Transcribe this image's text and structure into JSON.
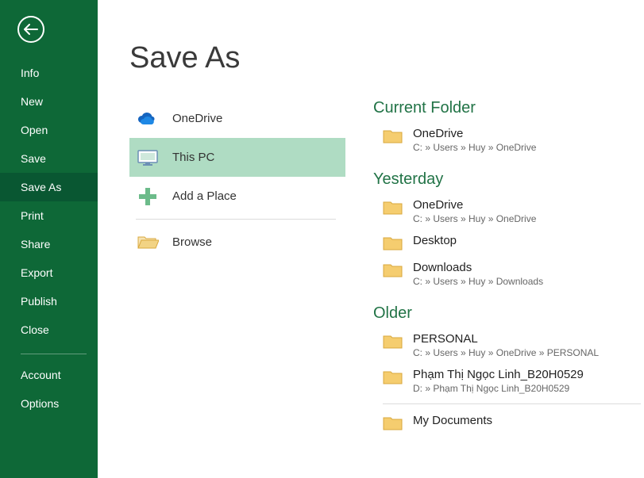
{
  "sidebar": {
    "items": [
      {
        "label": "Info",
        "id": "info"
      },
      {
        "label": "New",
        "id": "new"
      },
      {
        "label": "Open",
        "id": "open"
      },
      {
        "label": "Save",
        "id": "save"
      },
      {
        "label": "Save As",
        "id": "save-as",
        "active": true
      },
      {
        "label": "Print",
        "id": "print"
      },
      {
        "label": "Share",
        "id": "share"
      },
      {
        "label": "Export",
        "id": "export"
      },
      {
        "label": "Publish",
        "id": "publish"
      },
      {
        "label": "Close",
        "id": "close"
      }
    ],
    "bottom": [
      {
        "label": "Account",
        "id": "account"
      },
      {
        "label": "Options",
        "id": "options"
      }
    ]
  },
  "page_title": "Save As",
  "locations": [
    {
      "label": "OneDrive",
      "icon": "onedrive"
    },
    {
      "label": "This PC",
      "icon": "this-pc",
      "selected": true
    },
    {
      "label": "Add a Place",
      "icon": "add-place"
    },
    {
      "label": "Browse",
      "icon": "browse"
    }
  ],
  "groups": [
    {
      "title": "Current Folder",
      "folders": [
        {
          "name": "OneDrive",
          "path": "C: » Users » Huy » OneDrive"
        }
      ]
    },
    {
      "title": "Yesterday",
      "folders": [
        {
          "name": "OneDrive",
          "path": "C: » Users » Huy » OneDrive"
        },
        {
          "name": "Desktop",
          "path": ""
        },
        {
          "name": "Downloads",
          "path": "C: » Users » Huy » Downloads"
        }
      ]
    },
    {
      "title": "Older",
      "folders": [
        {
          "name": "PERSONAL",
          "path": "C: » Users » Huy » OneDrive » PERSONAL"
        },
        {
          "name": "Phạm Thị Ngọc Linh_B20H0529",
          "path": "D: » Phạm Thị Ngọc Linh_B20H0529"
        }
      ],
      "separator_after": true,
      "folders_after": [
        {
          "name": "My Documents",
          "path": ""
        }
      ]
    }
  ]
}
